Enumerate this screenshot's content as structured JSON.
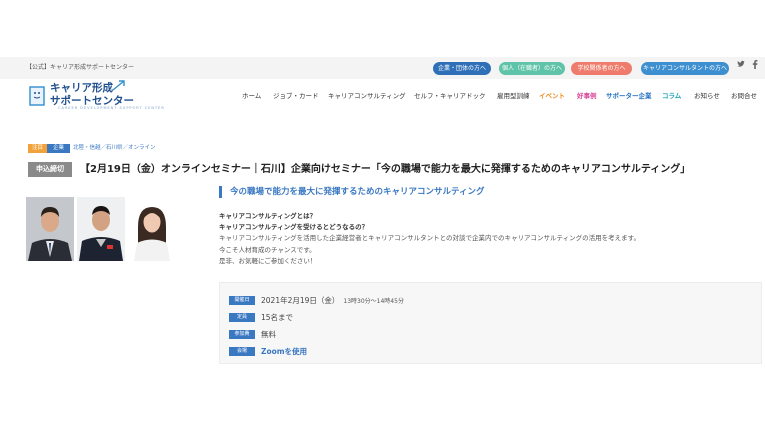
{
  "header": {
    "tagline": "【公式】キャリア形成サポートセンター",
    "audience_buttons": [
      {
        "label": "企業・団体の方へ",
        "color": "#2f6fb8"
      },
      {
        "label": "個人（在職者）の方へ",
        "color": "#5ec3a8"
      },
      {
        "label": "学校関係者の方へ",
        "color": "#ee7b6b"
      },
      {
        "label": "キャリアコンサルタントの方へ",
        "color": "#3e8fd0"
      }
    ],
    "social": {
      "twitter": "twitter-icon",
      "facebook": "facebook-icon"
    }
  },
  "logo": {
    "line1": "キャリア形成",
    "line2": "サポートセンター",
    "sub": "CAREER DEVELOPMENT SUPPORT CENTER"
  },
  "nav": {
    "items": [
      {
        "label": "ホーム",
        "color": "#333333"
      },
      {
        "label": "ジョブ・カード",
        "color": "#333333"
      },
      {
        "label": "キャリアコンサルティング",
        "color": "#333333"
      },
      {
        "label": "セルフ・キャリアドック",
        "color": "#333333"
      },
      {
        "label": "雇用型訓練",
        "color": "#333333"
      },
      {
        "label": "イベント",
        "color": "#f08a1c"
      },
      {
        "label": "好事例",
        "color": "#d9479a"
      },
      {
        "label": "サポーター企業",
        "color": "#1f6fc0"
      },
      {
        "label": "コラム",
        "color": "#1aa3b8"
      },
      {
        "label": "お知らせ",
        "color": "#333333"
      },
      {
        "label": "お問合せ",
        "color": "#333333"
      }
    ]
  },
  "breadcrumb": {
    "attention": "注目",
    "category": "企業",
    "location": "北陸・信越／石川県／オンライン"
  },
  "event": {
    "status": "申込締切",
    "title": "【2月19日（金）オンラインセミナー｜石川】企業向けセミナー「今の職場で能力を最大に発揮するためのキャリアコンサルティング」",
    "subheading": "今の職場で能力を最大に発揮するためのキャリアコンサルティング",
    "q1": "キャリアコンサルティングとは？",
    "q2": "キャリアコンサルティングを受けるとどうなるの？",
    "desc1": "キャリアコンサルティングを活用した企業経営者とキャリアコンサルタントとの対談で企業内でのキャリアコンサルティングの活用を考えます。",
    "desc2": "今こそ人材育成のチャンスです。",
    "desc3": "是非、お気軽にご参加ください！"
  },
  "details": {
    "date_label": "開催日",
    "date_value": "2021年2月19日（金）",
    "time_value": "13時30分～14時45分",
    "capacity_label": "定員",
    "capacity_value": "15名まで",
    "fee_label": "参加費",
    "fee_value": "無料",
    "venue_label": "会場",
    "venue_value": "Zoomを使用"
  },
  "colors": {
    "accent": "#3a78c2",
    "closed": "#8a8a8a",
    "attention": "#f3a23b"
  }
}
